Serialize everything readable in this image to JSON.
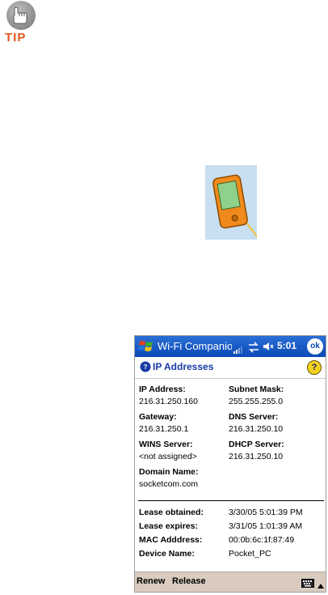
{
  "tip": {
    "label": "TIP"
  },
  "pda": {
    "app_title": "Wi-Fi Companion",
    "clock": "5:01",
    "ok_label": "ok",
    "header_title": "IP Addresses",
    "help_label": "?",
    "fields": {
      "ip_address": {
        "label": "IP Address:",
        "value": "216.31.250.160"
      },
      "subnet_mask": {
        "label": "Subnet Mask:",
        "value": "255.255.255.0"
      },
      "gateway": {
        "label": "Gateway:",
        "value": "216.31.250.1"
      },
      "dns_server": {
        "label": "DNS Server:",
        "value": "216.31.250.10"
      },
      "wins_server": {
        "label": "WINS Server:",
        "value": "<not assigned>"
      },
      "dhcp_server": {
        "label": "DHCP Server:",
        "value": "216.31.250.10"
      },
      "domain_name": {
        "label": "Domain Name:",
        "value": "socketcom.com"
      }
    },
    "lease": {
      "obtained": {
        "label": "Lease obtained:",
        "value": "3/30/05 5:01:39 PM"
      },
      "expires": {
        "label": "Lease expires:",
        "value": "3/31/05 1:01:39 AM"
      },
      "mac": {
        "label": "MAC Adddress:",
        "value": "00:0b:6c:1f:87:49"
      },
      "device": {
        "label": "Device Name:",
        "value": "Pocket_PC"
      }
    },
    "menu": {
      "renew": "Renew",
      "release": "Release"
    }
  },
  "icons": {
    "tip": "hand-pointer-icon",
    "device": "pocket-pc-device-icon",
    "start": "windows-flag-icon",
    "signal": "signal-strength-icon",
    "sync": "connectivity-arrows-icon",
    "volume": "speaker-icon",
    "header": "ip-address-icon",
    "help": "help-icon",
    "keyboard": "keyboard-icon",
    "sip": "up-arrow-icon"
  },
  "colors": {
    "titlebar": "#0a49b6",
    "header_text": "#1a3aa6",
    "menubar": "#d9ccbf",
    "tip_text": "#e2561f",
    "device_orange": "#f08a1c"
  }
}
